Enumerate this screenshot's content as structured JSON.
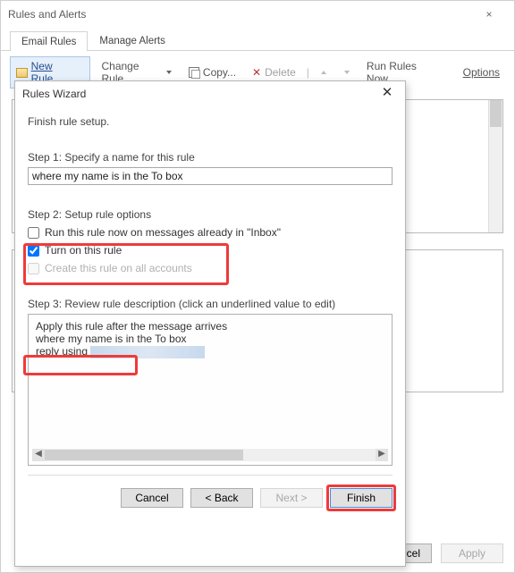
{
  "rulesAlerts": {
    "title": "Rules and Alerts",
    "close": "×",
    "tabs": {
      "email": "Email Rules",
      "manage": "Manage Alerts"
    },
    "toolbar": {
      "new": "New Rule...",
      "change": "Change Rule",
      "copy": "Copy...",
      "delete": "Delete",
      "run": "Run Rules Now...",
      "options": "Options"
    },
    "buttons": {
      "cancel": "cel",
      "apply": "Apply"
    }
  },
  "wizard": {
    "title": "Rules Wizard",
    "close": "✕",
    "heading": "Finish rule setup.",
    "step1": {
      "label": "Step 1: Specify a name for this rule",
      "value": "where my name is in the To box"
    },
    "step2": {
      "label": "Step 2: Setup rule options",
      "opt_run_now": "Run this rule now on messages already in \"Inbox\"",
      "opt_turn_on": "Turn on this rule",
      "opt_all_accounts": "Create this rule on all accounts"
    },
    "step3": {
      "label": "Step 3: Review rule description (click an underlined value to edit)",
      "line1": "Apply this rule after the message arrives",
      "line2": "where my name is in the To box",
      "line3_prefix": "reply using "
    },
    "buttons": {
      "cancel": "Cancel",
      "back": "<  Back",
      "next": "Next  >",
      "finish": "Finish"
    }
  }
}
